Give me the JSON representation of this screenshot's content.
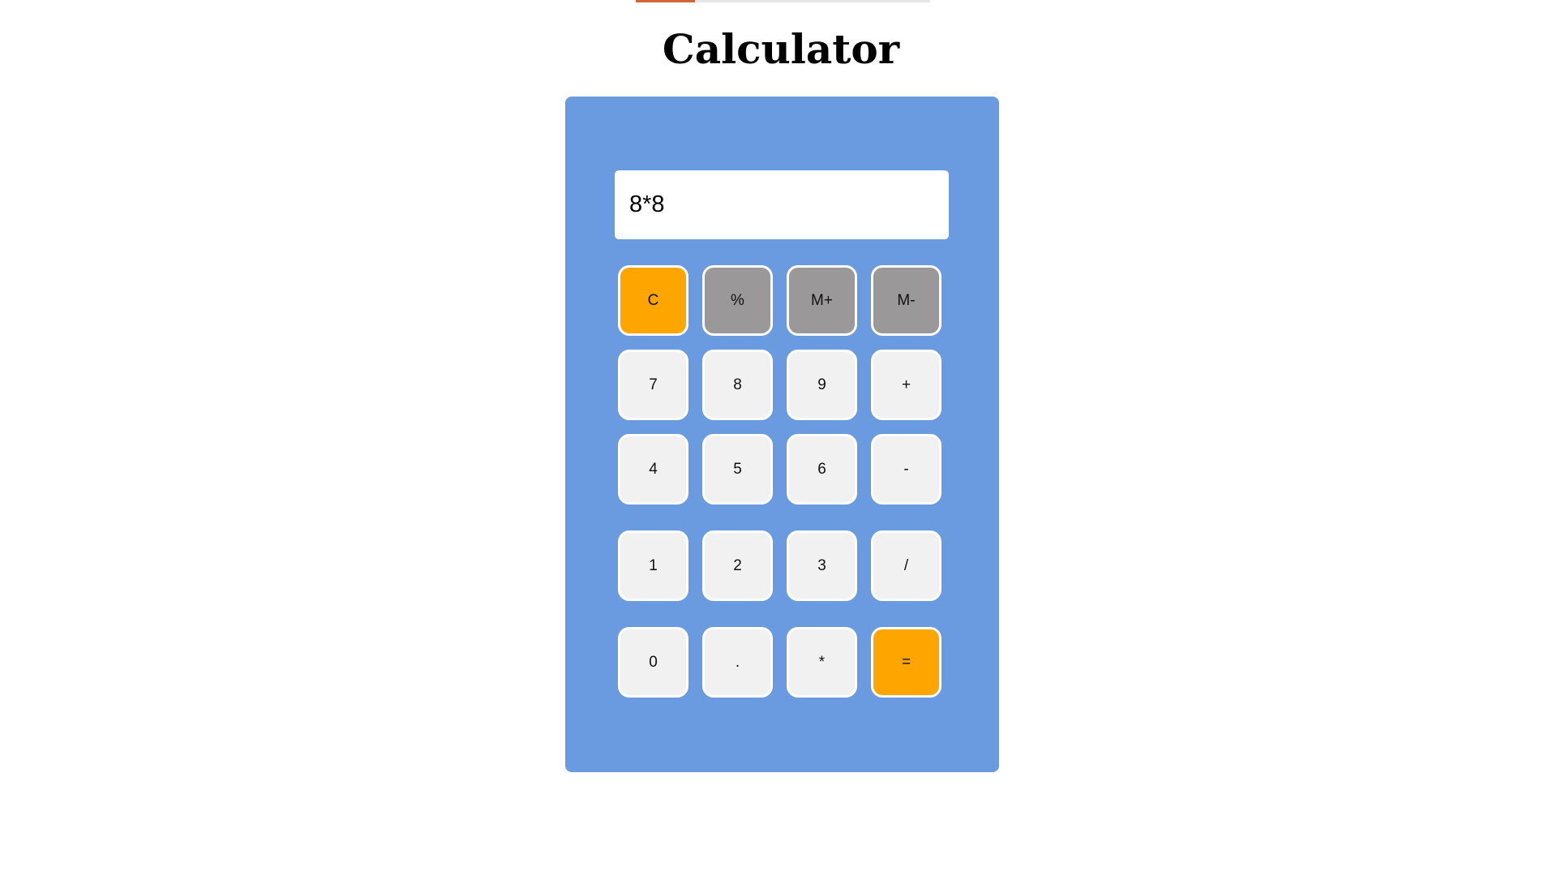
{
  "progress": {
    "fraction": 0.2
  },
  "header": {
    "title": "Calculator"
  },
  "display": {
    "value": "8*8"
  },
  "colors": {
    "body": "#6a9ae0",
    "accent": "#ffa500",
    "function": "#9a9898",
    "key": "#f1f1f1",
    "progress": "#d0643a"
  },
  "keys": {
    "clear": "C",
    "percent": "%",
    "mem_plus": "M+",
    "mem_minus": "M-",
    "seven": "7",
    "eight": "8",
    "nine": "9",
    "plus": "+",
    "four": "4",
    "five": "5",
    "six": "6",
    "minus": "-",
    "one": "1",
    "two": "2",
    "three": "3",
    "divide": "/",
    "zero": "0",
    "decimal": ".",
    "multiply": "*",
    "equals": "="
  }
}
